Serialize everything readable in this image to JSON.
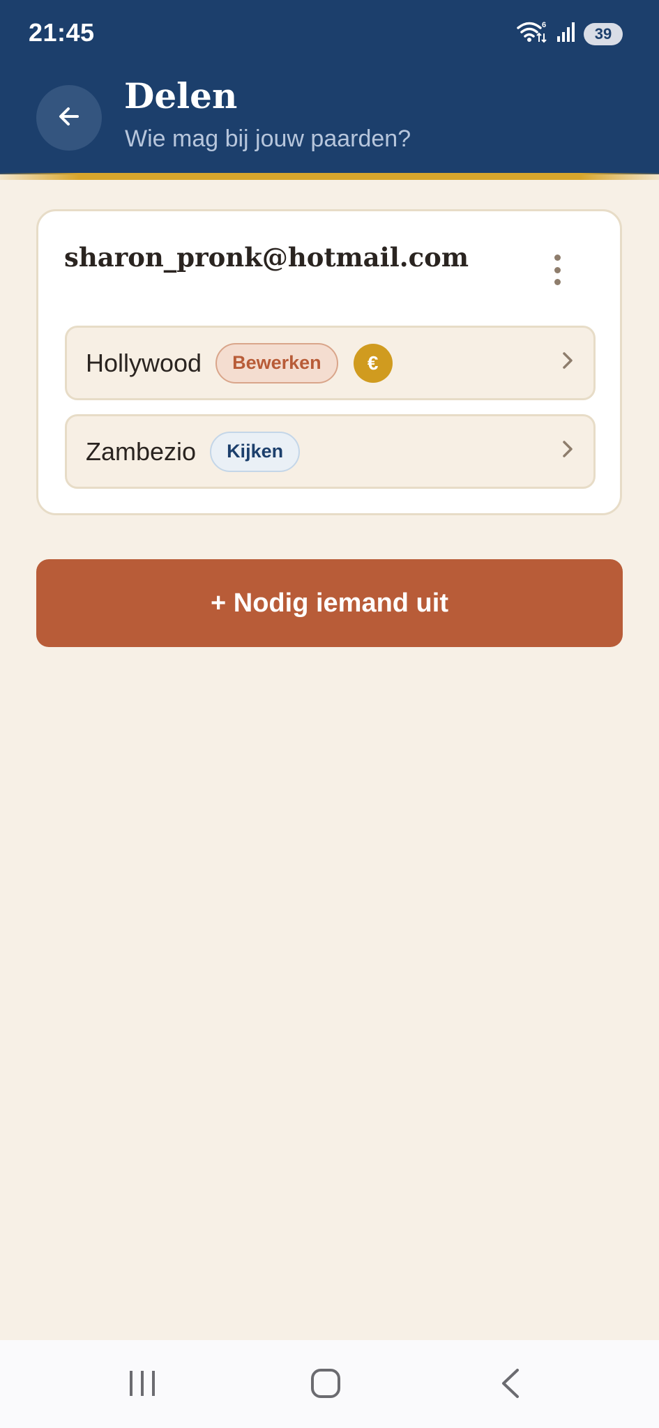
{
  "status_bar": {
    "time": "21:45",
    "wifi_badge": "6",
    "battery": "39"
  },
  "header": {
    "title": "Delen",
    "subtitle": "Wie mag bij jouw paarden?",
    "back_icon": "arrow-left-icon"
  },
  "share_card": {
    "email": "sharon_pronk@hotmail.com",
    "menu_icon": "more-vertical-icon",
    "horses": [
      {
        "name": "Hollywood",
        "permission": "Bewerken",
        "payment_icon": "€"
      },
      {
        "name": "Zambezio",
        "permission": "Kijken"
      }
    ]
  },
  "invite_button": {
    "label": "+ Nodig iemand uit"
  },
  "colors": {
    "header_bg": "#1c3f6c",
    "accent": "#b85c38",
    "gold": "#d09b1f",
    "background": "#f7f0e6"
  },
  "nav": {
    "recent_icon": "recent-apps-icon",
    "home_icon": "home-icon",
    "back_icon": "back-icon"
  }
}
